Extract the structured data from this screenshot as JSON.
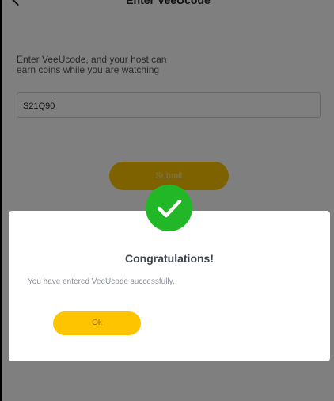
{
  "header": {
    "title": "Enter VeeUcode"
  },
  "form": {
    "instructions": "Enter VeeUcode, and your host can\nearn coins while you are watching",
    "code_value": "S21Q90",
    "submit_label": "Submit"
  },
  "dialog": {
    "title": "Congratulations!",
    "message": "You have entered VeeUcode successfully.",
    "ok_label": "Ok",
    "icon": "check-circle-icon"
  },
  "colors": {
    "accent": "#ffc400",
    "success": "#22b726",
    "overlay": "rgba(0,0,0,0.5)"
  }
}
